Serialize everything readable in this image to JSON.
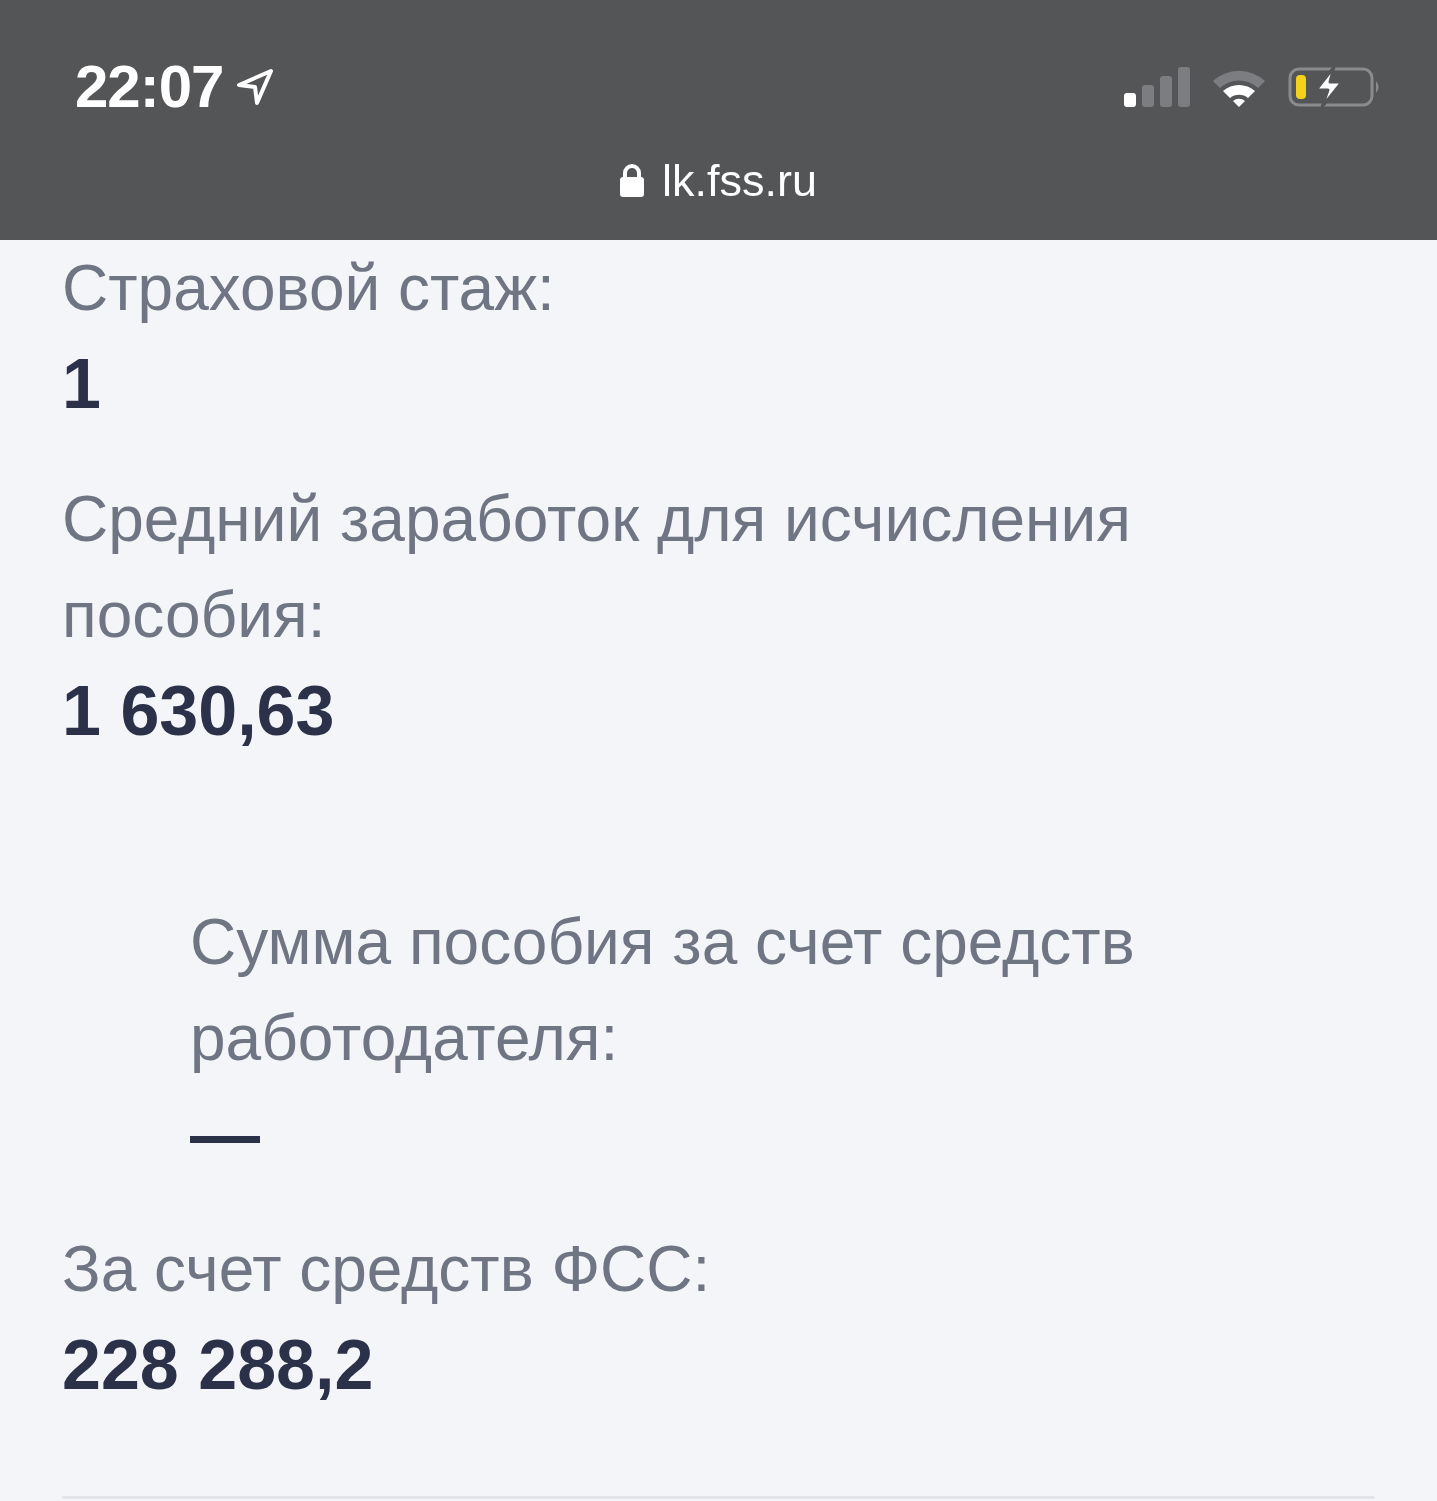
{
  "status_bar": {
    "time": "22:07"
  },
  "address_bar": {
    "url": "lk.fss.ru"
  },
  "fields": [
    {
      "label": "Страховой стаж:",
      "value": "1",
      "indented": false
    },
    {
      "label": "Средний заработок для исчисления пособия:",
      "value": "1 630,63",
      "indented": false
    },
    {
      "label": "Сумма пособия за счет средств работодателя:",
      "value": "—",
      "indented": true
    },
    {
      "label": "За счет средств ФСС:",
      "value": "228 288,2",
      "indented": false
    }
  ]
}
